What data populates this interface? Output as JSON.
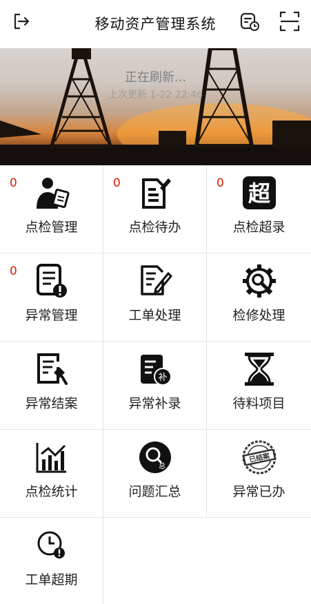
{
  "header": {
    "title": "移动资产管理系统"
  },
  "banner": {
    "refresh_text": "正在刷新...",
    "updated_text": "上次更新 1-22 22:46"
  },
  "grid": [
    {
      "label": "点检管理",
      "badge": "0",
      "icon": "inspector-person-icon"
    },
    {
      "label": "点检待办",
      "badge": "0",
      "icon": "document-edit-icon"
    },
    {
      "label": "点检超录",
      "badge": "0",
      "icon": "chao-icon"
    },
    {
      "label": "异常管理",
      "badge": "0",
      "icon": "list-alert-icon"
    },
    {
      "label": "工单处理",
      "icon": "document-pen-icon"
    },
    {
      "label": "检修处理",
      "icon": "gear-wrench-icon"
    },
    {
      "label": "异常结案",
      "icon": "document-brush-icon"
    },
    {
      "label": "异常补录",
      "icon": "document-supplement-icon"
    },
    {
      "label": "待料项目",
      "icon": "hourglass-icon"
    },
    {
      "label": "点检统计",
      "icon": "bar-chart-icon"
    },
    {
      "label": "问题汇总",
      "icon": "magnifier-summary-icon"
    },
    {
      "label": "异常已办",
      "icon": "closed-stamp-icon"
    },
    {
      "label": "工单超期",
      "icon": "clock-alert-icon"
    }
  ]
}
